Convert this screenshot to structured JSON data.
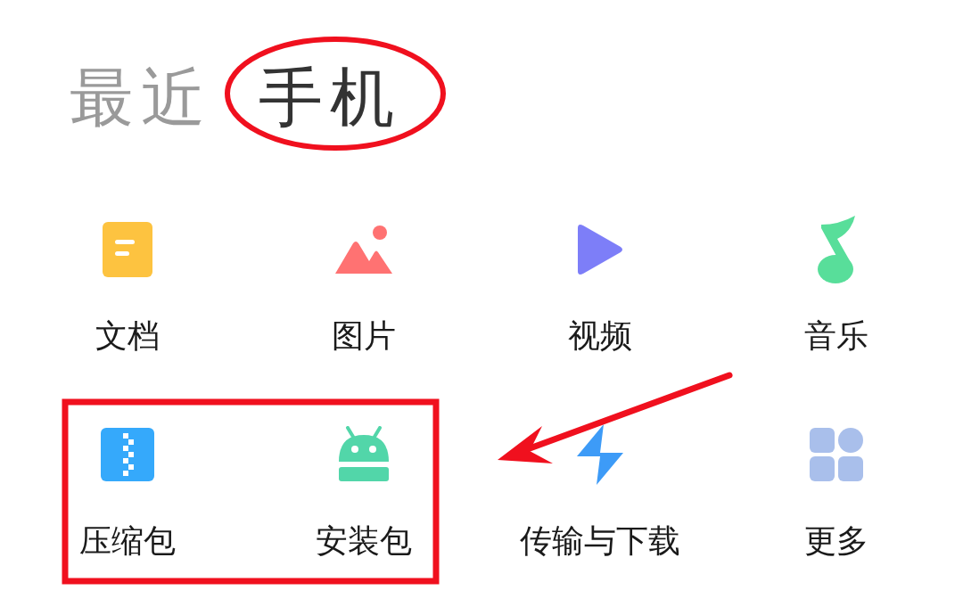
{
  "tabs": [
    {
      "label": "最近",
      "selected": false
    },
    {
      "label": "手机",
      "selected": true
    }
  ],
  "categories": [
    {
      "kind": "document",
      "label": "文档"
    },
    {
      "kind": "image",
      "label": "图片"
    },
    {
      "kind": "video",
      "label": "视频"
    },
    {
      "kind": "music",
      "label": "音乐"
    },
    {
      "kind": "archive",
      "label": "压缩包"
    },
    {
      "kind": "apk",
      "label": "安装包"
    },
    {
      "kind": "transfer",
      "label": "传输与下载"
    },
    {
      "kind": "more",
      "label": "更多"
    }
  ]
}
